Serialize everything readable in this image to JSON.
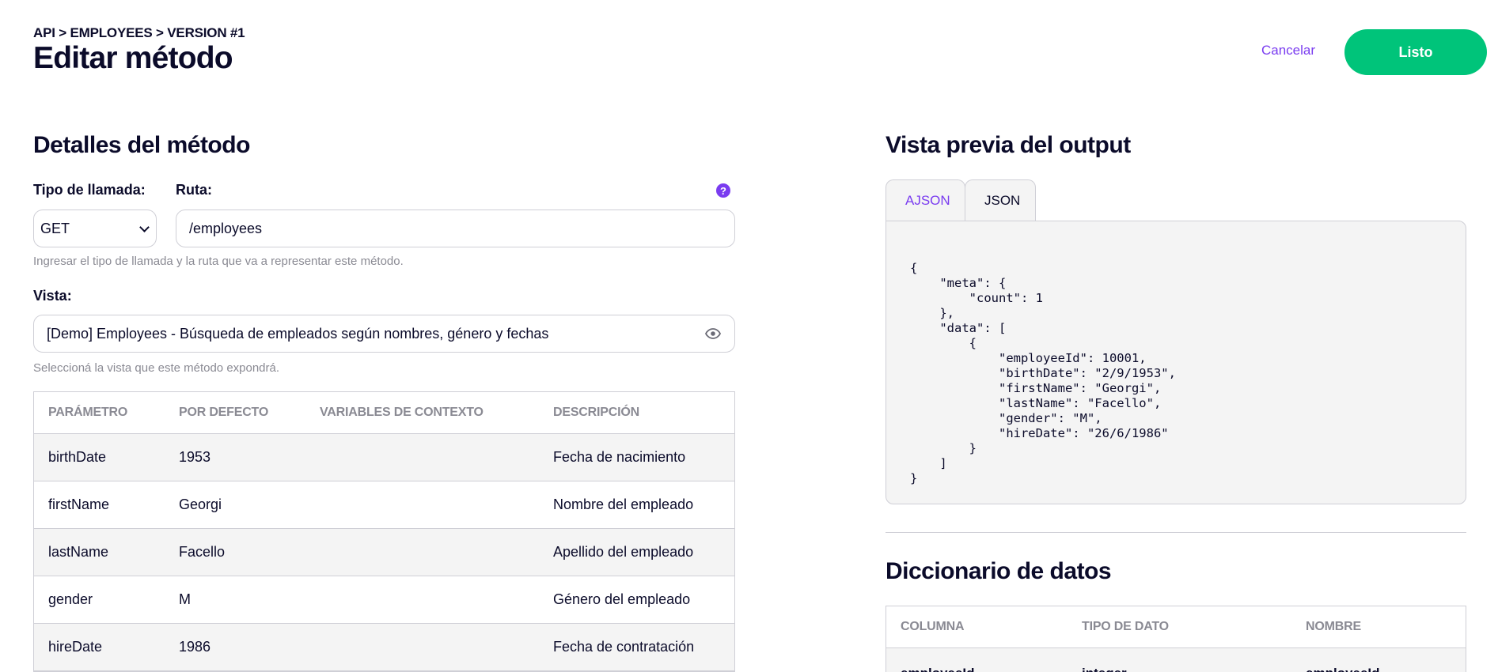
{
  "header": {
    "breadcrumb": "API > EMPLOYEES > VERSION #1",
    "title": "Editar método",
    "cancel_label": "Cancelar",
    "done_label": "Listo"
  },
  "method_details": {
    "title": "Detalles del método",
    "call_type_label": "Tipo de llamada:",
    "route_label": "Ruta:",
    "help_icon": "question-icon",
    "call_type_value": "GET",
    "route_value": "/employees",
    "route_hint": "Ingresar el tipo de llamada y la ruta que va a representar este método.",
    "view_label": "Vista:",
    "view_value": "[Demo] Employees - Búsqueda de empleados según nombres, género y fechas",
    "view_hint": "Seleccioná la vista que este método expondrá."
  },
  "params_table": {
    "headers": [
      "PARÁMETRO",
      "POR DEFECTO",
      "VARIABLES DE CONTEXTO",
      "DESCRIPCIÓN"
    ],
    "rows": [
      {
        "param": "birthDate",
        "default": "1953",
        "context": "",
        "description": "Fecha de nacimiento"
      },
      {
        "param": "firstName",
        "default": "Georgi",
        "context": "",
        "description": "Nombre del empleado"
      },
      {
        "param": "lastName",
        "default": "Facello",
        "context": "",
        "description": "Apellido del empleado"
      },
      {
        "param": "gender",
        "default": "M",
        "context": "",
        "description": "Género del empleado"
      },
      {
        "param": "hireDate",
        "default": "1986",
        "context": "",
        "description": "Fecha de contratación"
      }
    ]
  },
  "output_preview": {
    "title": "Vista previa del output",
    "tabs": [
      "AJSON",
      "JSON"
    ],
    "active_tab": "JSON",
    "json_text": "{\n    \"meta\": {\n        \"count\": 1\n    },\n    \"data\": [\n        {\n            \"employeeId\": 10001,\n            \"birthDate\": \"2/9/1953\",\n            \"firstName\": \"Georgi\",\n            \"lastName\": \"Facello\",\n            \"gender\": \"M\",\n            \"hireDate\": \"26/6/1986\"\n        }\n    ]\n}"
  },
  "data_dictionary": {
    "title": "Diccionario de datos",
    "headers": [
      "COLUMNA",
      "TIPO DE DATO",
      "NOMBRE"
    ],
    "rows": [
      {
        "column": "employeeId",
        "type": "integer",
        "name": "employeeId"
      }
    ]
  },
  "colors": {
    "accent": "#7a3cf0",
    "primary_button": "#00c47a",
    "text": "#0b0b2a",
    "muted": "#8a8a93",
    "border": "#cfcfd6",
    "row_alt": "#f4f4f4"
  }
}
